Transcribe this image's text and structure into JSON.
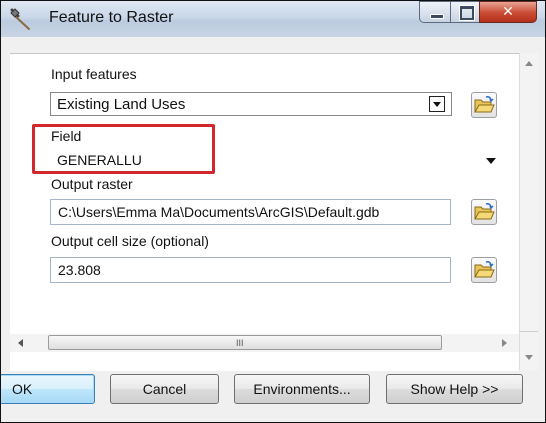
{
  "window": {
    "title": "Feature to Raster",
    "minimize_glyph": "",
    "close_glyph": "✕"
  },
  "form": {
    "input_features": {
      "label": "Input features",
      "value": "Existing Land Uses"
    },
    "field": {
      "label": "Field",
      "value": "GENERALLU"
    },
    "output_raster": {
      "label": "Output raster",
      "value": "C:\\Users\\Emma Ma\\Documents\\ArcGIS\\Default.gdb"
    },
    "cell_size": {
      "label": "Output cell size (optional)",
      "value": "23.808"
    }
  },
  "scrollbar": {
    "grip": "III"
  },
  "buttons": {
    "ok": "OK",
    "cancel": "Cancel",
    "environments": "Environments...",
    "show_help": "Show Help >>"
  },
  "colors": {
    "highlight": "#d0282c",
    "close_button": "#c94a32"
  }
}
